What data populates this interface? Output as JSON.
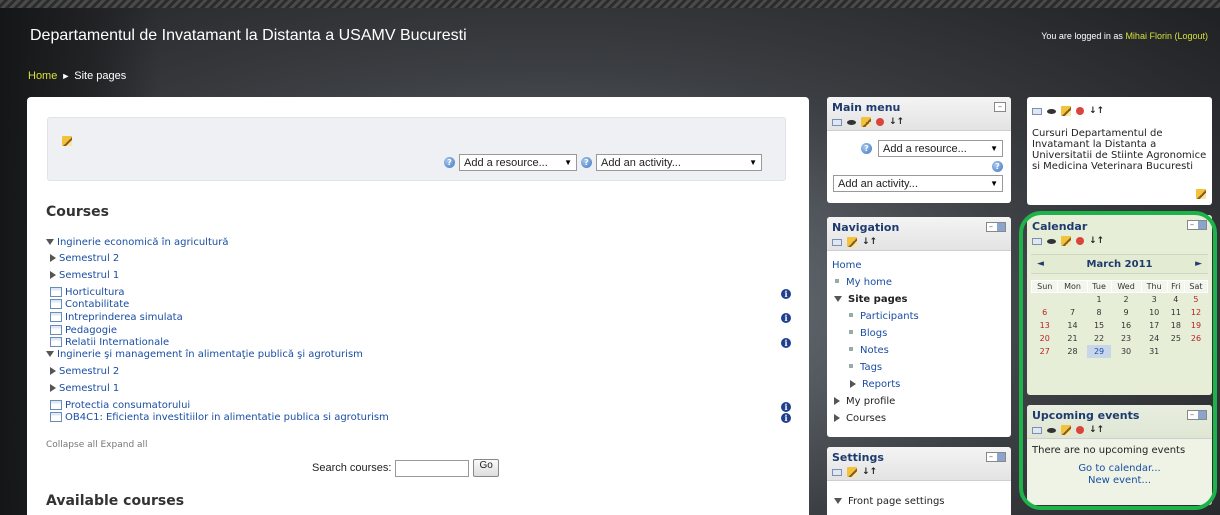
{
  "site": {
    "title": "Departamentul de Invatamant la Distanta a USAMV Bucuresti",
    "login_prefix": "You are logged in as ",
    "login_user": "Mihai Florin",
    "login_logout": "(Logout)"
  },
  "breadcrumb": {
    "home": "Home",
    "separator": "►",
    "current": "Site pages"
  },
  "editbar": {
    "add_resource": "Add a resource...",
    "add_activity": "Add an activity..."
  },
  "main": {
    "courses_heading": "Courses",
    "tree": {
      "cat1": "Inginerie economică în agricultură",
      "sem2": "Semestrul 2",
      "sem1": "Semestrul 1",
      "c1": "Horticultura",
      "c2": "Contabilitate",
      "c3": "Intreprinderea simulata",
      "c4": "Pedagogie",
      "c5": "Relatii Internationale",
      "cat2": "Inginerie şi management în alimentaţie publică şi agroturism",
      "sem2b": "Semestrul 2",
      "sem1b": "Semestrul 1",
      "c6": "Protectia consumatorului",
      "c7": "OB4C1: Eficienta investitiilor in alimentatie publica si agroturism"
    },
    "collapse_all": "Collapse all",
    "expand_all": "Expand all",
    "search_label": "Search courses:",
    "go": "Go",
    "available_heading": "Available courses"
  },
  "main_menu": {
    "title": "Main menu",
    "add_resource": "Add a resource...",
    "add_activity": "Add an activity..."
  },
  "navigation": {
    "title": "Navigation",
    "home": "Home",
    "my_home": "My home",
    "site_pages": "Site pages",
    "participants": "Participants",
    "blogs": "Blogs",
    "notes": "Notes",
    "tags": "Tags",
    "reports": "Reports",
    "my_profile": "My profile",
    "courses": "Courses"
  },
  "settings": {
    "title": "Settings",
    "front_page": "Front page settings"
  },
  "html_block": {
    "text": "Cursuri Departamentul de Invatamant la Distanta a Universitatii de Stiinte Agronomice si Medicina Veterinara Bucuresti"
  },
  "calendar": {
    "title": "Calendar",
    "month": "March 2011",
    "prev": "◄",
    "next": "►",
    "weekdays": [
      "Sun",
      "Mon",
      "Tue",
      "Wed",
      "Thu",
      "Fri",
      "Sat"
    ],
    "weeks": [
      [
        "",
        "",
        "1",
        "2",
        "3",
        "4",
        "5"
      ],
      [
        "6",
        "7",
        "8",
        "9",
        "10",
        "11",
        "12"
      ],
      [
        "13",
        "14",
        "15",
        "16",
        "17",
        "18",
        "19"
      ],
      [
        "20",
        "21",
        "22",
        "23",
        "24",
        "25",
        "26"
      ],
      [
        "27",
        "28",
        "29",
        "30",
        "31",
        "",
        ""
      ]
    ]
  },
  "upcoming": {
    "title": "Upcoming events",
    "none": "There are no upcoming events",
    "go_calendar": "Go to calendar...",
    "new_event": "New event..."
  }
}
